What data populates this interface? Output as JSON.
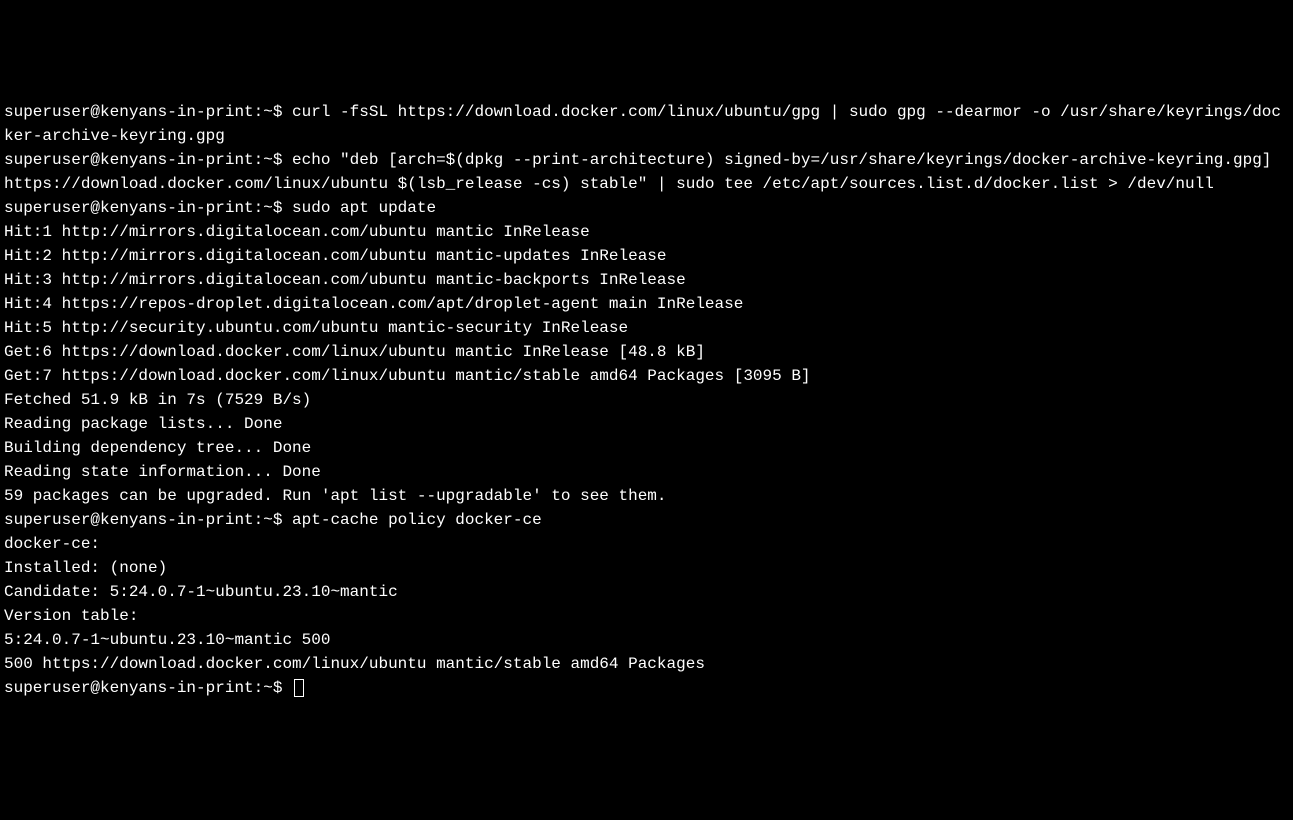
{
  "prompt": "superuser@kenyans-in-print:~$",
  "lines": [
    "superuser@kenyans-in-print:~$ curl -fsSL https://download.docker.com/linux/ubuntu/gpg | sudo gpg --dearmor -o /usr/share/keyrings/docker-archive-keyring.gpg",
    "superuser@kenyans-in-print:~$ echo \"deb [arch=$(dpkg --print-architecture) signed-by=/usr/share/keyrings/docker-archive-keyring.gpg] https://download.docker.com/linux/ubuntu $(lsb_release -cs) stable\" | sudo tee /etc/apt/sources.list.d/docker.list > /dev/null",
    "superuser@kenyans-in-print:~$ sudo apt update",
    "Hit:1 http://mirrors.digitalocean.com/ubuntu mantic InRelease",
    "Hit:2 http://mirrors.digitalocean.com/ubuntu mantic-updates InRelease",
    "Hit:3 http://mirrors.digitalocean.com/ubuntu mantic-backports InRelease",
    "Hit:4 https://repos-droplet.digitalocean.com/apt/droplet-agent main InRelease",
    "Hit:5 http://security.ubuntu.com/ubuntu mantic-security InRelease",
    "Get:6 https://download.docker.com/linux/ubuntu mantic InRelease [48.8 kB]",
    "Get:7 https://download.docker.com/linux/ubuntu mantic/stable amd64 Packages [3095 B]",
    "Fetched 51.9 kB in 7s (7529 B/s)",
    "Reading package lists... Done",
    "Building dependency tree... Done",
    "Reading state information... Done",
    "59 packages can be upgraded. Run 'apt list --upgradable' to see them.",
    "superuser@kenyans-in-print:~$ apt-cache policy docker-ce",
    "docker-ce:",
    "  Installed: (none)",
    "  Candidate: 5:24.0.7-1~ubuntu.23.10~mantic",
    "  Version table:",
    "     5:24.0.7-1~ubuntu.23.10~mantic 500",
    "        500 https://download.docker.com/linux/ubuntu mantic/stable amd64 Packages"
  ],
  "final_prompt": "superuser@kenyans-in-print:~$ "
}
